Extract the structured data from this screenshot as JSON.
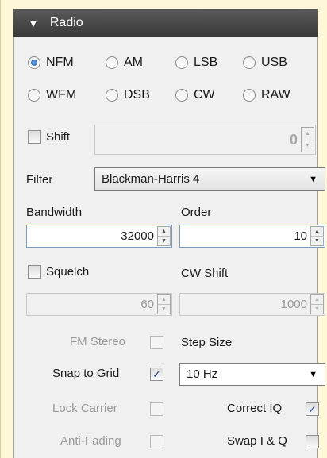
{
  "panel": {
    "title": "Radio"
  },
  "modes": [
    {
      "label": "NFM",
      "checked": true
    },
    {
      "label": "AM",
      "checked": false
    },
    {
      "label": "LSB",
      "checked": false
    },
    {
      "label": "USB",
      "checked": false
    },
    {
      "label": "WFM",
      "checked": false
    },
    {
      "label": "DSB",
      "checked": false
    },
    {
      "label": "CW",
      "checked": false
    },
    {
      "label": "RAW",
      "checked": false
    }
  ],
  "shift": {
    "label": "Shift",
    "checked": false,
    "value": "0"
  },
  "filter": {
    "label": "Filter",
    "selected": "Blackman-Harris 4"
  },
  "bandwidth": {
    "label": "Bandwidth",
    "value": "32000"
  },
  "order": {
    "label": "Order",
    "value": "10"
  },
  "squelch": {
    "label": "Squelch",
    "checked": false,
    "value": "60"
  },
  "cw_shift": {
    "label": "CW Shift",
    "value": "1000"
  },
  "fm_stereo": {
    "label": "FM Stereo",
    "checked": false
  },
  "step_size": {
    "label": "Step Size",
    "selected": "10 Hz"
  },
  "snap_to_grid": {
    "label": "Snap to Grid",
    "checked": true
  },
  "lock_carrier": {
    "label": "Lock Carrier",
    "checked": false
  },
  "correct_iq": {
    "label": "Correct IQ",
    "checked": true
  },
  "anti_fading": {
    "label": "Anti-Fading",
    "checked": false
  },
  "swap_iq": {
    "label": "Swap I & Q",
    "checked": false
  },
  "glyphs": {
    "triangle_down": "▼",
    "check": "✓",
    "spin_up": "▲",
    "spin_down": "▼"
  }
}
